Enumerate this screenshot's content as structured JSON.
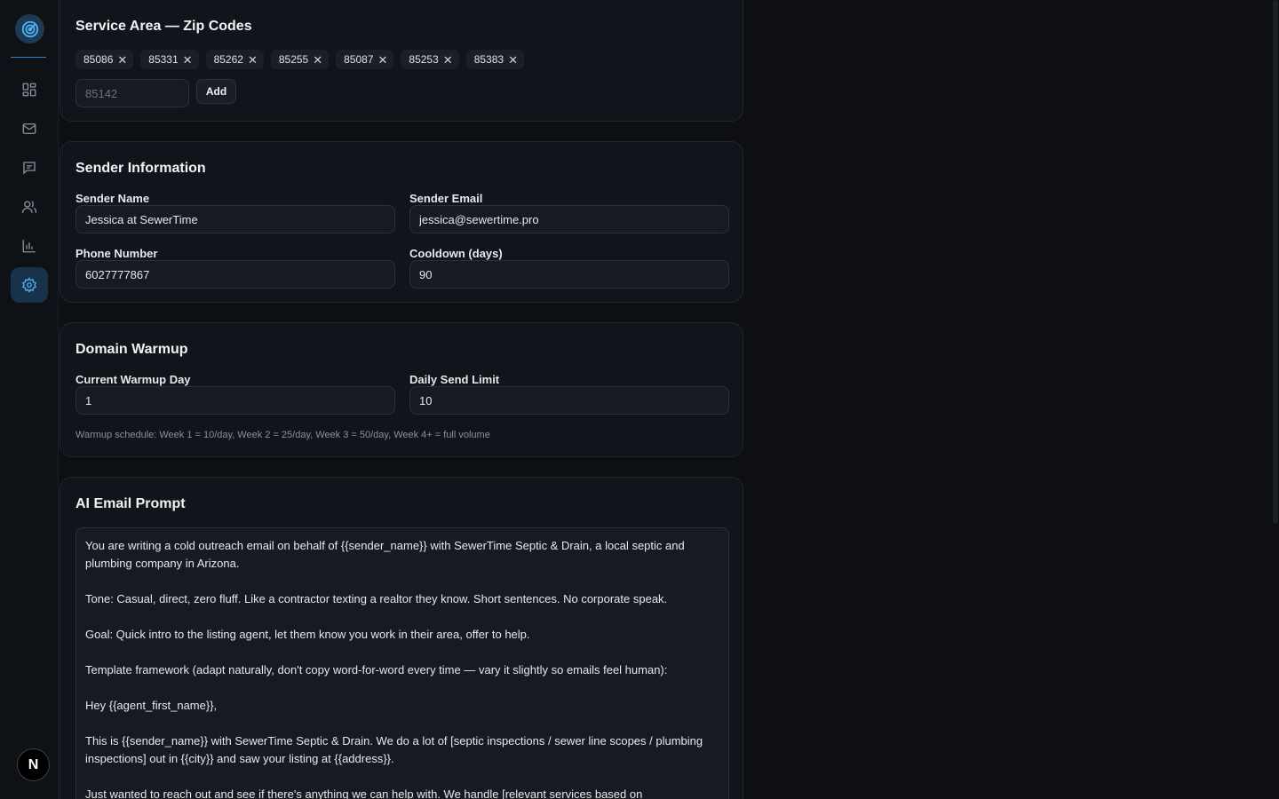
{
  "sidebar": {
    "nav_items": [
      {
        "icon": "dashboard-icon",
        "active": false
      },
      {
        "icon": "mail-icon",
        "active": false
      },
      {
        "icon": "messages-icon",
        "active": false
      },
      {
        "icon": "contacts-icon",
        "active": false
      },
      {
        "icon": "analytics-icon",
        "active": false
      },
      {
        "icon": "settings-icon",
        "active": true
      }
    ],
    "avatar_letter": "N"
  },
  "service_area": {
    "title": "Service Area — Zip Codes",
    "zip_codes": [
      "85086",
      "85331",
      "85262",
      "85255",
      "85087",
      "85253",
      "85383"
    ],
    "remove_glyph": "✕",
    "input_placeholder": "85142",
    "add_label": "Add"
  },
  "sender_info": {
    "title": "Sender Information",
    "sender_name_label": "Sender Name",
    "sender_name_value": "Jessica at SewerTime",
    "sender_email_label": "Sender Email",
    "sender_email_value": "jessica@sewertime.pro",
    "phone_label": "Phone Number",
    "phone_value": "6027777867",
    "cooldown_label": "Cooldown (days)",
    "cooldown_value": "90"
  },
  "domain_warmup": {
    "title": "Domain Warmup",
    "current_day_label": "Current Warmup Day",
    "current_day_value": "1",
    "daily_limit_label": "Daily Send Limit",
    "daily_limit_value": "10",
    "schedule_hint": "Warmup schedule: Week 1 = 10/day, Week 2 = 25/day, Week 3 = 50/day, Week 4+ = full volume"
  },
  "ai_prompt": {
    "title": "AI Email Prompt",
    "prompt_text": "You are writing a cold outreach email on behalf of {{sender_name}} with SewerTime Septic & Drain, a local septic and plumbing company in Arizona.\n\nTone: Casual, direct, zero fluff. Like a contractor texting a realtor they know. Short sentences. No corporate speak.\n\nGoal: Quick intro to the listing agent, let them know you work in their area, offer to help.\n\nTemplate framework (adapt naturally, don't copy word-for-word every time — vary it slightly so emails feel human):\n\nHey {{agent_first_name}},\n\nThis is {{sender_name}} with SewerTime Septic & Drain. We do a lot of [septic inspections / sewer line scopes / plumbing inspections] out in {{city}} and saw your listing at {{address}}.\n\nJust wanted to reach out and see if there's anything we can help with. We handle [relevant services based on"
  }
}
